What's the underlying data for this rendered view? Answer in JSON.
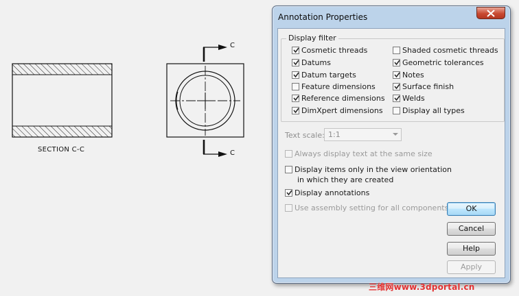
{
  "drawing": {
    "section_label": "SECTION C-C",
    "cut_label_top": "C",
    "cut_label_bottom": "C"
  },
  "dialog": {
    "title": "Annotation Properties",
    "display_filter": {
      "legend": "Display filter",
      "left": [
        {
          "label": "Cosmetic threads",
          "checked": true
        },
        {
          "label": "Datums",
          "checked": true
        },
        {
          "label": "Datum targets",
          "checked": true
        },
        {
          "label": "Feature dimensions",
          "checked": false
        },
        {
          "label": "Reference dimensions",
          "checked": true
        },
        {
          "label": "DimXpert dimensions",
          "checked": true
        }
      ],
      "right": [
        {
          "label": "Shaded cosmetic threads",
          "checked": false
        },
        {
          "label": "Geometric tolerances",
          "checked": true
        },
        {
          "label": "Notes",
          "checked": true
        },
        {
          "label": "Surface finish",
          "checked": true
        },
        {
          "label": "Welds",
          "checked": true
        },
        {
          "label": "Display all types",
          "checked": false
        }
      ]
    },
    "text_scale": {
      "label": "Text scale:",
      "value": "1:1"
    },
    "always_same_size": {
      "label": "Always display text at the same size",
      "checked": false,
      "enabled": false
    },
    "display_only_view": {
      "label_line1": "Display items only in the view orientation",
      "label_line2": "in which they are created",
      "checked": false,
      "enabled": true
    },
    "display_annotations": {
      "label": "Display annotations",
      "checked": true,
      "enabled": true
    },
    "use_assembly": {
      "label": "Use assembly setting for all components",
      "checked": false,
      "enabled": false
    },
    "buttons": {
      "ok": "OK",
      "cancel": "Cancel",
      "help": "Help",
      "apply": "Apply"
    }
  },
  "watermark": "三维网www.3dportal.cn"
}
